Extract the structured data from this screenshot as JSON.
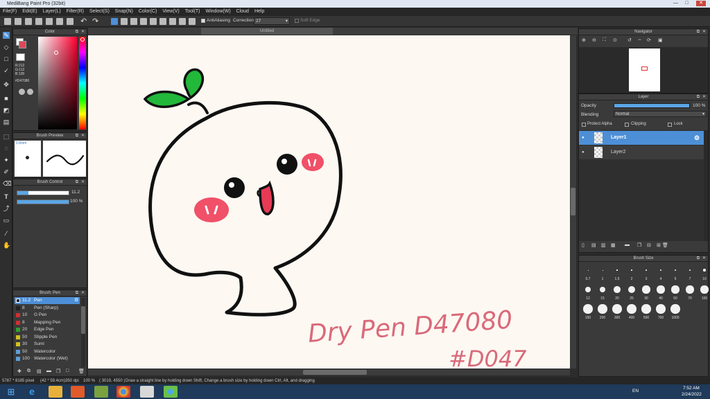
{
  "window": {
    "title": "MediBang Paint Pro (32bit)",
    "min": "—",
    "max": "□",
    "close": "✕"
  },
  "menu": [
    "File(F)",
    "Edit(E)",
    "Layer(L)",
    "Filter(R)",
    "Select(S)",
    "Snap(N)",
    "Color(C)",
    "View(V)",
    "Tool(T)",
    "Window(W)",
    "Cloud",
    "Help"
  ],
  "toolbar": {
    "antialiasing_label": "AntiAliasing",
    "correction_label": "Correction",
    "correction_value": "27",
    "soft_edge_label": "Soft Edge"
  },
  "document": {
    "tab_title": "Untitled"
  },
  "color_panel": {
    "title": "Color",
    "r": "R:212",
    "g": "G:112",
    "b": "B:128",
    "hex": "#D47080",
    "primary_color": "#d94a5a",
    "secondary_color": "#ffffff"
  },
  "brush_preview": {
    "title": "Brush Preview",
    "size_label": "0.8mm"
  },
  "brush_control": {
    "title": "Brush Control",
    "size_value": "11.2",
    "opacity_value": "100 %"
  },
  "brush_list": {
    "title": "Brush: Pen",
    "items": [
      {
        "size": "11.2",
        "name": "Pen",
        "color": "#1c2a3a",
        "selected": true
      },
      {
        "size": "8",
        "name": "Pen (Sharp)",
        "color": "#222222"
      },
      {
        "size": "10",
        "name": "G Pen",
        "color": "#d03030"
      },
      {
        "size": "8",
        "name": "Mapping Pen",
        "color": "#d03030"
      },
      {
        "size": "20",
        "name": "Edge Pen",
        "color": "#30a030"
      },
      {
        "size": "50",
        "name": "Stipple Pen",
        "color": "#d0c020"
      },
      {
        "size": "30",
        "name": "Sumi",
        "color": "#d0c020"
      },
      {
        "size": "50",
        "name": "Watercolor",
        "color": "#5aa0d8"
      },
      {
        "size": "100",
        "name": "Watercolor (Wet)",
        "color": "#5aa0d8"
      }
    ]
  },
  "navigator": {
    "title": "Navigator"
  },
  "layer_panel": {
    "title": "Layer",
    "opacity_label": "Opacity",
    "opacity_value": "100 %",
    "blending_label": "Blending",
    "blending_value": "Normal",
    "protect_alpha_label": "Protect Alpha",
    "clipping_label": "Clipping",
    "lock_label": "Lock",
    "layers": [
      {
        "name": "Layer1",
        "selected": true
      },
      {
        "name": "Layer2",
        "selected": false
      }
    ]
  },
  "brush_size": {
    "title": "Brush Size",
    "sizes": [
      "0.7",
      "1",
      "1.5",
      "2",
      "3",
      "4",
      "5",
      "7",
      "10",
      "12",
      "15",
      "20",
      "25",
      "30",
      "40",
      "50",
      "70",
      "100",
      "150",
      "200",
      "300",
      "400",
      "500",
      "700",
      "1000"
    ]
  },
  "status": {
    "canvas_size": "5787 * 8185 pixel",
    "canvas_physical": "(42 * 59.4cm)",
    "dpi": "350 dpi",
    "zoom": "100 %",
    "coords": "( 3019, 4550 )",
    "hint": "Draw a straight line by holding down Shift, Change a brush size by holding down Ctrl, Alt, and dragging"
  },
  "taskbar": {
    "lang": "EN",
    "time": "7:52 AM",
    "date": "2/24/2022"
  },
  "canvas_text": {
    "line1": "Dry Pen D47080",
    "line2": "#D047"
  }
}
